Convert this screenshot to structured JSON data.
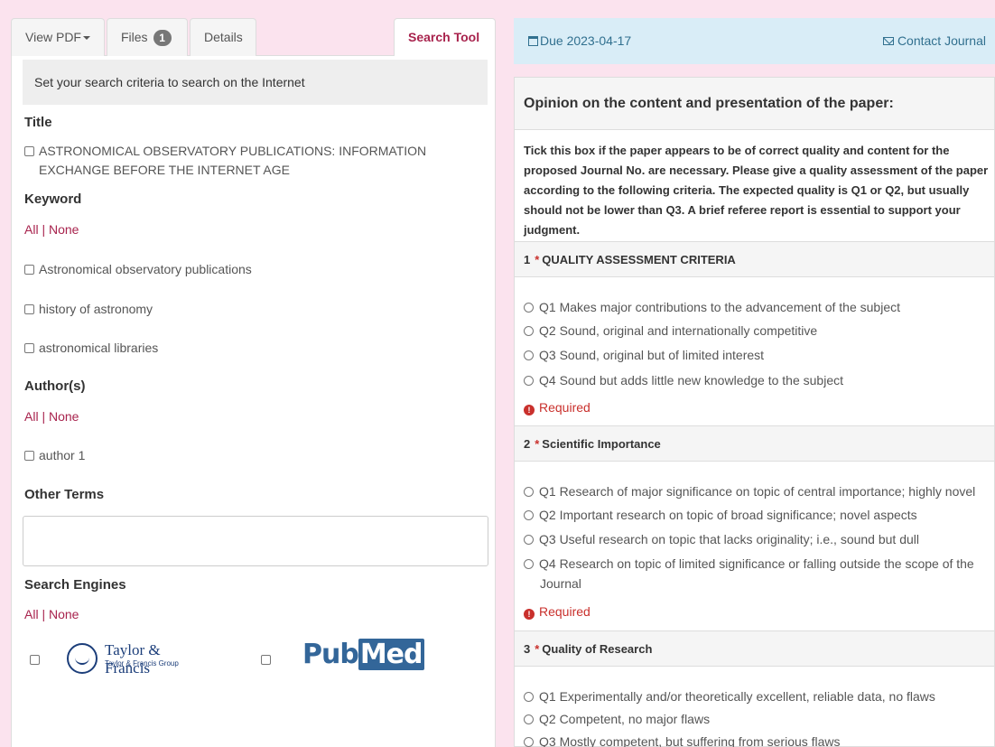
{
  "tabs": [
    {
      "label": "View PDF"
    },
    {
      "label": "Files",
      "badge": "1"
    },
    {
      "label": "Details"
    },
    {
      "label": "Search Tool",
      "active": true
    }
  ],
  "search": {
    "hint": "Set your search criteria to search on the Internet",
    "title_heading": "Title",
    "title_value": "ASTRONOMICAL OBSERVATORY PUBLICATIONS: INFORMATION EXCHANGE BEFORE THE INTERNET AGE",
    "keyword_heading": "Keyword",
    "all": "All",
    "separator": " | ",
    "none": "None",
    "keywords": [
      "Astronomical observatory publications",
      "history of astronomy",
      "astronomical libraries"
    ],
    "authors_heading": "Author(s)",
    "authors": [
      "author 1"
    ],
    "other_terms_heading": "Other Terms",
    "other_terms_value": "",
    "engines_heading": "Search Engines",
    "engines": [
      {
        "name": "Taylor & Francis",
        "sub": "Taylor & Francis Group"
      },
      {
        "name_a": "Pub",
        "name_b": "Med"
      }
    ]
  },
  "review": {
    "due": "Due 2023-04-17",
    "contact": "Contact Journal",
    "card_title": "Opinion on the content and presentation of the paper:",
    "intro": "Tick this box if the paper appears to be of correct quality and content for the proposed Journal No. are necessary. Please give a quality assessment of the paper according to the following criteria. The expected quality is Q1 or Q2, but usually should not be lower than Q3. A brief referee report is essential to support your judgment.",
    "required_label": "Required",
    "questions": [
      {
        "num": "1",
        "star": "*",
        "title": "QUALITY ASSESSMENT CRITERIA",
        "options": [
          "Q1 Makes major contributions to the advancement of the subject",
          "Q2 Sound, original and internationally competitive",
          "Q3 Sound, original but of limited interest",
          "Q4 Sound but adds little new knowledge to the subject"
        ]
      },
      {
        "num": "2",
        "star": "*",
        "title": "Scientific Importance",
        "options": [
          "Q1 Research of major significance on topic of central importance; highly novel",
          "Q2 Important research on topic of broad significance; novel aspects",
          "Q3 Useful research on topic that lacks originality; i.e., sound but dull",
          "Q4 Research on topic of limited significance or falling outside the scope of the Journal"
        ]
      },
      {
        "num": "3",
        "star": "*",
        "title": "Quality of Research",
        "options": [
          "Q1 Experimentally and/or theoretically excellent, reliable data, no flaws",
          "Q2 Competent, no major flaws",
          "Q3 Mostly competent, but suffering from serious flaws"
        ]
      }
    ]
  }
}
